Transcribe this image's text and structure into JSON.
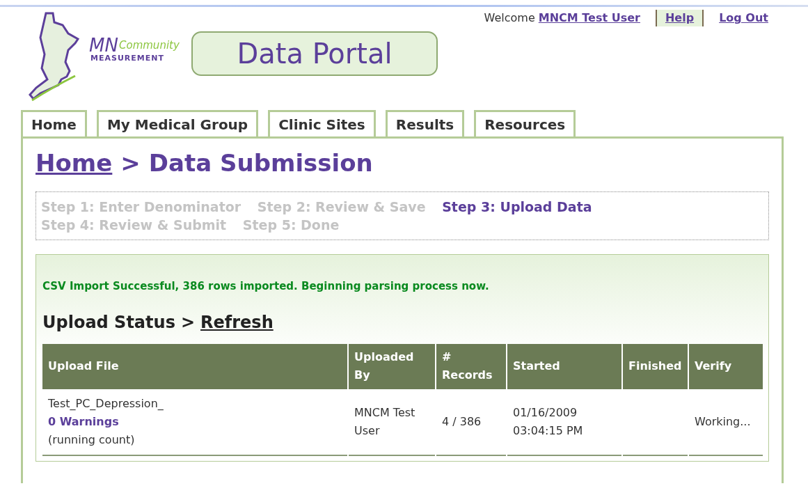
{
  "header": {
    "logo": {
      "mn": "MN",
      "community": "Community",
      "measurement": "MEASUREMENT"
    },
    "portal_title": "Data Portal",
    "welcome": "Welcome",
    "user": "MNCM Test User",
    "links": [
      {
        "label": "Help",
        "highlighted": true
      },
      {
        "label": "Log Out",
        "highlighted": false
      }
    ]
  },
  "tabs": [
    {
      "label": "Home",
      "selected": false
    },
    {
      "label": "My Medical Group",
      "selected": false
    },
    {
      "label": "Clinic Sites",
      "selected": false
    },
    {
      "label": "Results",
      "selected": false
    },
    {
      "label": "Resources",
      "selected": false
    }
  ],
  "breadcrumb": {
    "link": "Home",
    "separator": ">",
    "current": "Data Submission"
  },
  "steps": [
    {
      "label": "Step 1: Enter Denominator",
      "selected": false
    },
    {
      "label": "Step 2: Review & Save",
      "selected": false
    },
    {
      "label": "Step 3: Upload Data",
      "selected": true
    },
    {
      "label": "Step 4: Review & Submit",
      "selected": false
    },
    {
      "label": "Step 5: Done",
      "selected": false
    }
  ],
  "message": "CSV Import Successful, 386 rows imported. Beginning parsing process now.",
  "upload_status": {
    "title": "Upload Status",
    "separator": ">",
    "refresh": "Refresh"
  },
  "table": {
    "columns": [
      "Upload File",
      "Uploaded By",
      "# Records",
      "Started",
      "Finished",
      "Verify"
    ],
    "rows": [
      {
        "file": "Test_PC_Depression_",
        "warnings": "0 Warnings",
        "note": "(running count)",
        "uploaded_by": "MNCM Test User",
        "records": "4 / 386",
        "started": "01/16/2009 03:04:15 PM",
        "finished": "",
        "verify": "Working..."
      }
    ]
  }
}
